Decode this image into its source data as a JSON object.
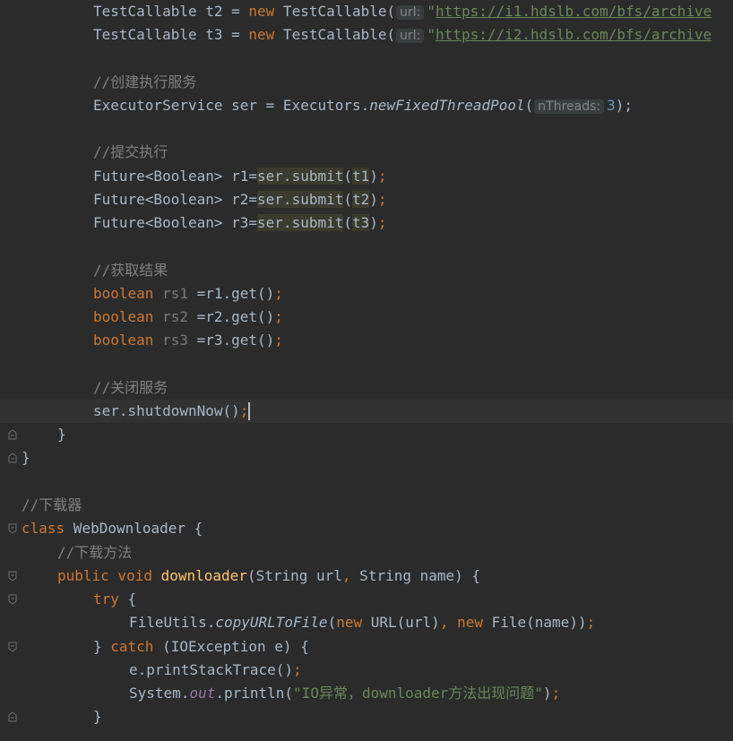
{
  "editor": {
    "hints": {
      "url": "url:",
      "nthreads": "nThreads:"
    },
    "lines": {
      "l1": {
        "a": "TestCallable t2 = ",
        "kw": "new",
        "b": " TestCallable(",
        "q": "\"",
        "url": "https://i1.hdslb.com/bfs/archive"
      },
      "l2": {
        "a": "TestCallable t3 = ",
        "kw": "new",
        "b": " TestCallable(",
        "q": "\"",
        "url": "https://i2.hdslb.com/bfs/archive"
      },
      "l4": {
        "comment": "//创建执行服务"
      },
      "l5": {
        "a": "ExecutorService ser = Executors.",
        "method": "newFixedThreadPool",
        "b": "(",
        "num": "3",
        "c": ");"
      },
      "l7": {
        "comment": "//提交执行"
      },
      "l8": {
        "a": "Future<Boolean> r1=",
        "hl": "ser.submit",
        "p1": "(",
        "arg": "t1",
        "p2": ")",
        "semi": ";"
      },
      "l9": {
        "a": "Future<Boolean> r2=",
        "hl": "ser.submit",
        "p1": "(",
        "arg": "t2",
        "p2": ")",
        "semi": ";"
      },
      "l10": {
        "a": "Future<Boolean> r3=",
        "hl": "ser.submit",
        "p1": "(",
        "arg": "t3",
        "p2": ")",
        "semi": ";"
      },
      "l12": {
        "comment": "//获取结果"
      },
      "l13": {
        "kw": "boolean",
        "var": " rs1",
        "b": " =r1.get()",
        "semi": ";"
      },
      "l14": {
        "kw": "boolean",
        "var": " rs2",
        "b": " =r2.get()",
        "semi": ";"
      },
      "l15": {
        "kw": "boolean",
        "var": " rs3",
        "b": " =r3.get()",
        "semi": ";"
      },
      "l17": {
        "comment": "//关闭服务"
      },
      "l18": {
        "a": "ser.shutdownNow()",
        "semi": ";"
      },
      "l19": {
        "a": "}"
      },
      "l20": {
        "a": "}"
      },
      "l22": {
        "comment": "//下载器"
      },
      "l23": {
        "kw": "class",
        "a": " WebDownloader {"
      },
      "l24": {
        "comment": "//下载方法"
      },
      "l25": {
        "kw1": "public",
        "kw2": " void",
        "fn": " downloader",
        "a": "(String url",
        "comma": ",",
        "b": " String name) {"
      },
      "l26": {
        "kw": "try",
        "a": " {"
      },
      "l27": {
        "a": "FileUtils.",
        "method": "copyURLToFile",
        "b": "(",
        "kw1": "new",
        "c": " URL(url)",
        "comma": ",",
        "kw2": " new",
        "d": " File(name))",
        "semi": ";"
      },
      "l28": {
        "a": "} ",
        "kw": "catch",
        "b": " (IOException e) {"
      },
      "l29": {
        "a": "e.printStackTrace()",
        "semi": ";"
      },
      "l30": {
        "a": "System.",
        "field": "out",
        "b": ".println(",
        "str": "\"IO异常，downloader方法出现问题\"",
        "c": ")",
        "semi": ";"
      },
      "l31": {
        "a": "}"
      }
    }
  }
}
